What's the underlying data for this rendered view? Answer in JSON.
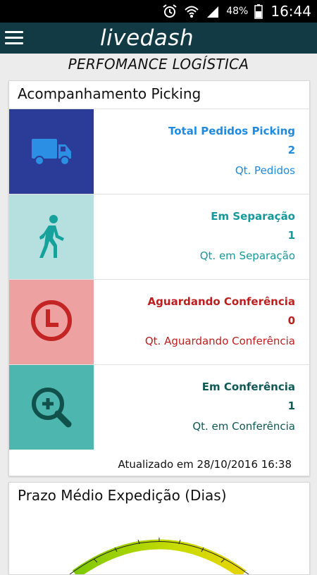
{
  "statusbar": {
    "battery": "48%",
    "time": "16:44"
  },
  "appbar": {
    "logo": "livedash"
  },
  "page": {
    "title": "PERFOMANCE LOGÍSTICA"
  },
  "picking": {
    "title": "Acompanhamento Picking",
    "rows": [
      {
        "label": "Total Pedidos Picking",
        "value": "2",
        "sub": "Qt. Pedidos",
        "icon": "truck-icon",
        "tile_color": "#2b3c98",
        "icon_color": "#2b90e3",
        "text_color": "#1e8ae0"
      },
      {
        "label": "Em Separação",
        "value": "1",
        "sub": "Qt. em Separação",
        "icon": "walking-person-icon",
        "tile_color": "#b6e0df",
        "icon_color": "#16a19c",
        "text_color": "#16999a"
      },
      {
        "label": "Aguardando Conferência",
        "value": "0",
        "sub": "Qt. Aguardando Conferência",
        "icon": "clock-icon",
        "tile_color": "#eea1a1",
        "icon_color": "#c32424",
        "text_color": "#be1e1e"
      },
      {
        "label": "Em Conferência",
        "value": "1",
        "sub": "Qt. em Conferência",
        "icon": "zoom-in-icon",
        "tile_color": "#4db6ae",
        "icon_color": "#11514c",
        "text_color": "#105a55"
      }
    ],
    "updated": "Atualizado em 28/10/2016 16:38"
  },
  "expedicao": {
    "title": "Prazo Médio Expedição (Dias)"
  }
}
